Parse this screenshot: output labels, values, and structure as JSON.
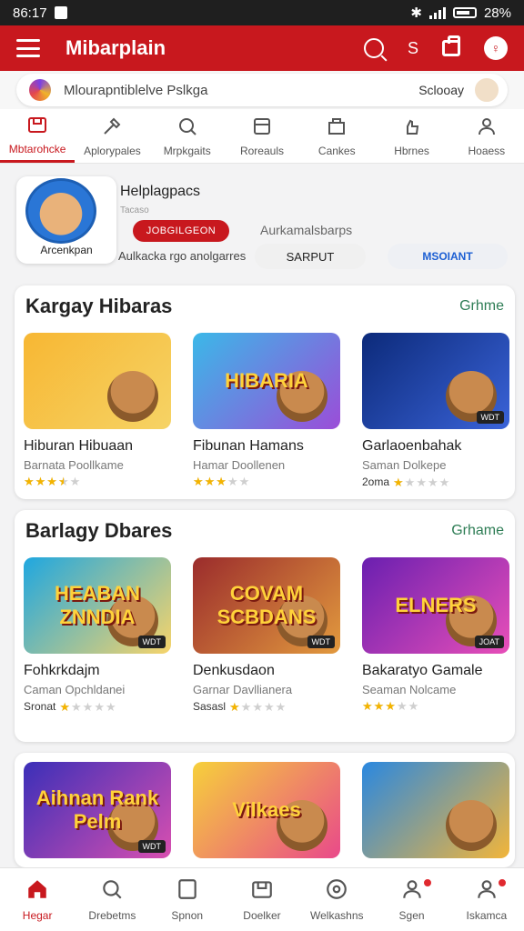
{
  "status": {
    "time": "86:17",
    "right": "28%"
  },
  "app": {
    "title": "Mibarplain",
    "search_letter": "S"
  },
  "search": {
    "placeholder": "Mlourapntiblelve Pslkga",
    "right_text": "Sclooay"
  },
  "tabs": [
    {
      "label": "Mbtarohcke",
      "icon": "box-icon",
      "active": true
    },
    {
      "label": "Aplorypales",
      "icon": "tools-icon",
      "active": false
    },
    {
      "label": "Mrpkgaits",
      "icon": "magnifier-icon",
      "active": false
    },
    {
      "label": "Roreauls",
      "icon": "printer-icon",
      "active": false
    },
    {
      "label": "Cankes",
      "icon": "shop-icon",
      "active": false
    },
    {
      "label": "Hbrnes",
      "icon": "hand-icon",
      "active": false
    },
    {
      "label": "Hoaess",
      "icon": "person-icon",
      "active": false
    }
  ],
  "profile": {
    "avatar_name": "Arcenkpan",
    "title": "Helplagpacs",
    "subtitle": "Tacaso",
    "button": "JOBGILGEON",
    "meta": "Aurkamalsbarps",
    "desc": "Aulkacka rgo anolgarres",
    "pill_a": "SARPUT",
    "pill_b": "MSOIANT"
  },
  "sections": [
    {
      "title": "Kargay Hibaras",
      "link": "Grhme",
      "games": [
        {
          "name": "Hiburan Hibuaan",
          "sub": "Barnata Poollkame",
          "rating_label": "",
          "rating": 3.5,
          "thumb_text": "",
          "tag": "",
          "colors": [
            "#f7b733",
            "#f6d365"
          ]
        },
        {
          "name": "Fibunan Hamans",
          "sub": "Hamar Doollenen",
          "rating_label": "",
          "rating": 3,
          "thumb_text": "HIBARIA",
          "tag": "",
          "colors": [
            "#3bb8e8",
            "#9b4dd8"
          ]
        },
        {
          "name": "Garlaoenbahak",
          "sub": "Saman Dolkepe",
          "rating_label": "2oma",
          "rating": 1,
          "thumb_text": "",
          "tag": "WDT",
          "colors": [
            "#0c2a7a",
            "#3a63d8"
          ]
        }
      ]
    },
    {
      "title": "Barlagy Dbares",
      "link": "Grhame",
      "games": [
        {
          "name": "Fohkrkdajm",
          "sub": "Caman Opchldanei",
          "rating_label": "Sronat",
          "rating": 1,
          "thumb_text": "HEABAN ZNNDIA",
          "tag": "WDT",
          "colors": [
            "#1fa7e0",
            "#f7d46a"
          ]
        },
        {
          "name": "Denkusdaon",
          "sub": "Garnar Davllianera",
          "rating_label": "Sasasl",
          "rating": 1,
          "thumb_text": "COVAM SCBDANS",
          "tag": "WDT",
          "colors": [
            "#9b2c2c",
            "#e29a3e"
          ]
        },
        {
          "name": "Bakaratyo Gamale",
          "sub": "Seaman Nolcame",
          "rating_label": "",
          "rating": 3,
          "thumb_text": "ELNERS",
          "tag": "JOAT",
          "colors": [
            "#6a1fb0",
            "#e84fb8"
          ]
        }
      ]
    },
    {
      "title": "",
      "link": "",
      "games": [
        {
          "name": "",
          "sub": "",
          "rating_label": "",
          "rating": 0,
          "thumb_text": "Aihnan Rank Pelm",
          "tag": "WDT",
          "colors": [
            "#3b2fb8",
            "#d84fb0"
          ]
        },
        {
          "name": "",
          "sub": "",
          "rating_label": "",
          "rating": 0,
          "thumb_text": "Vilkaes",
          "tag": "",
          "colors": [
            "#f6d03b",
            "#e9498a"
          ]
        },
        {
          "name": "",
          "sub": "",
          "rating_label": "",
          "rating": 0,
          "thumb_text": "",
          "tag": "",
          "colors": [
            "#2a88e0",
            "#f2b53a"
          ]
        }
      ]
    }
  ],
  "bottom_nav": [
    {
      "label": "Hegar",
      "icon": "home-icon",
      "active": true,
      "badge": false
    },
    {
      "label": "Drebetms",
      "icon": "search-icon",
      "active": false,
      "badge": false
    },
    {
      "label": "Spnon",
      "icon": "folder-icon",
      "active": false,
      "badge": false
    },
    {
      "label": "Doelker",
      "icon": "box-icon",
      "active": false,
      "badge": false
    },
    {
      "label": "Welkashns",
      "icon": "compass-icon",
      "active": false,
      "badge": false
    },
    {
      "label": "Sgen",
      "icon": "user-icon",
      "active": false,
      "badge": true
    },
    {
      "label": "Iskamca",
      "icon": "profile-icon",
      "active": false,
      "badge": true
    }
  ],
  "colors": {
    "brand": "#c8181e",
    "link": "#2e7d55",
    "star": "#f4b400"
  }
}
